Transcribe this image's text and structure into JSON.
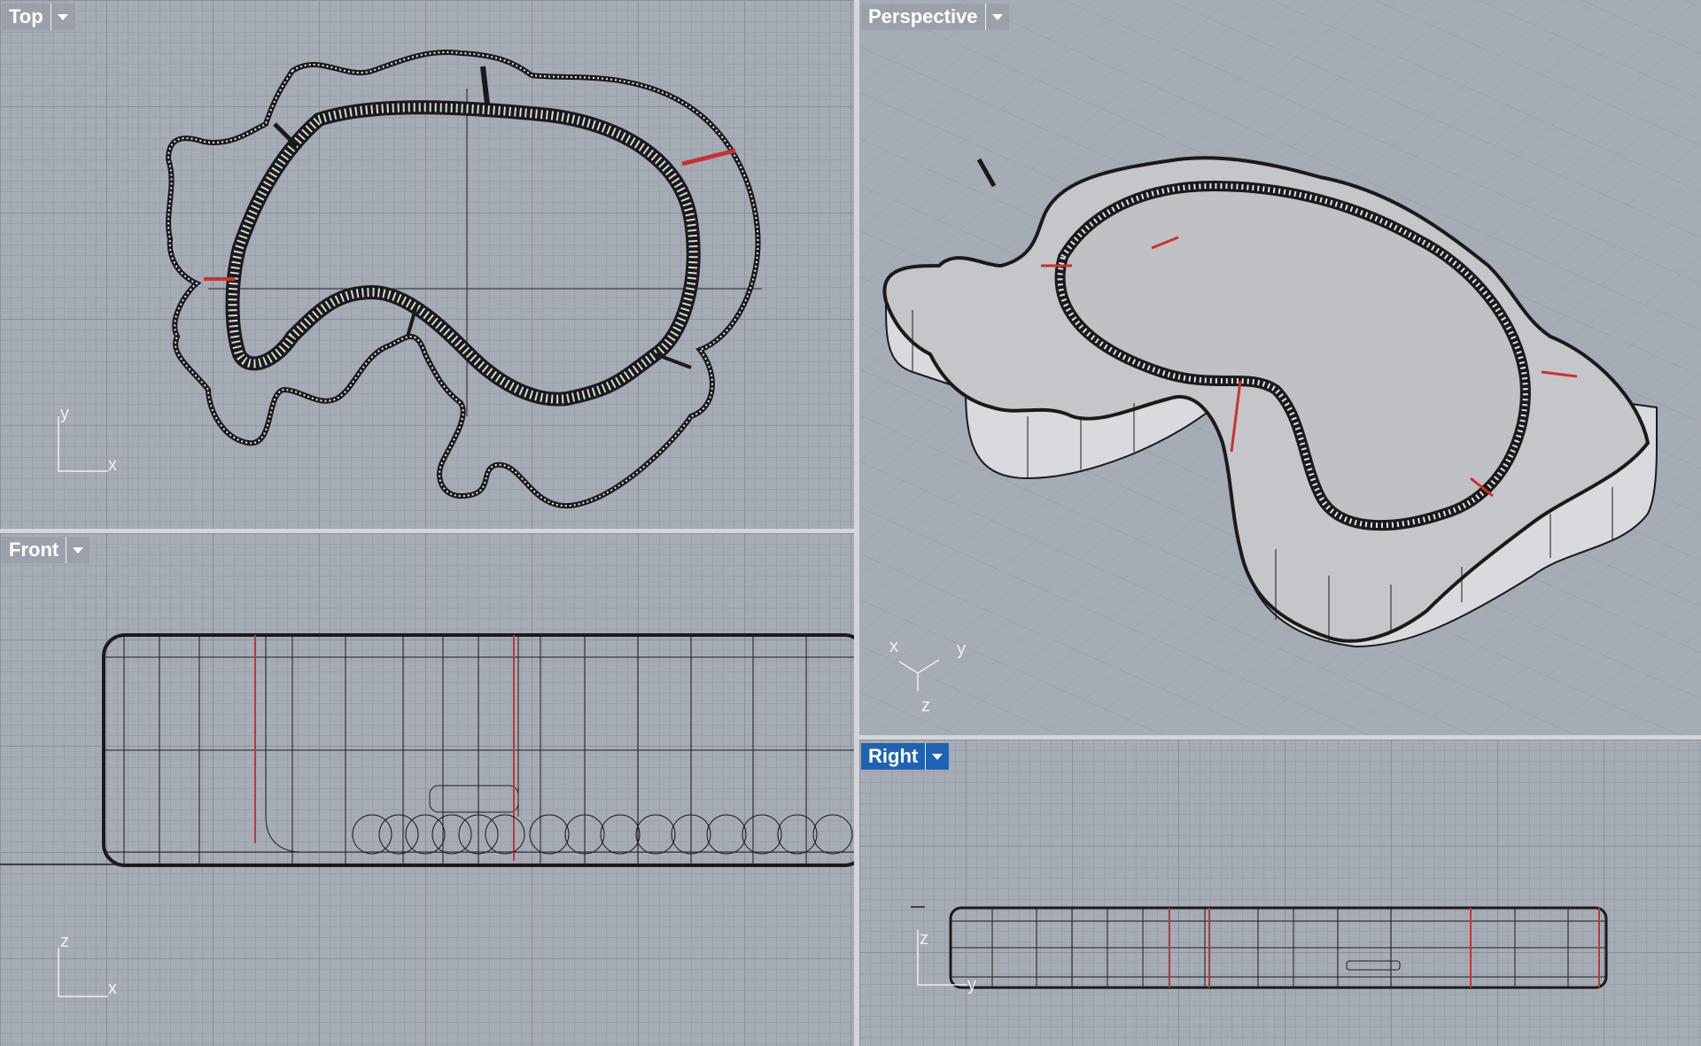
{
  "viewports": {
    "top": {
      "name": "Top",
      "axes": [
        "y",
        "x"
      ],
      "active": false
    },
    "front": {
      "name": "Front",
      "axes": [
        "z",
        "x"
      ],
      "active": false
    },
    "perspective": {
      "name": "Perspective",
      "axes": [
        "x",
        "y",
        "z"
      ],
      "active": false
    },
    "right": {
      "name": "Right",
      "axes": [
        "z",
        "y"
      ],
      "active": true
    }
  },
  "icons": {
    "viewport_menu": "chevron-down-icon"
  },
  "colors": {
    "viewport_bg": "#a6acb6",
    "grid_minor": "#9ba1ab",
    "grid_major": "#8a919b",
    "active_tab": "#1f62b4",
    "wire": "#1a1a1a",
    "seam": "#d23c3c",
    "surface": "#c4c6ca"
  }
}
